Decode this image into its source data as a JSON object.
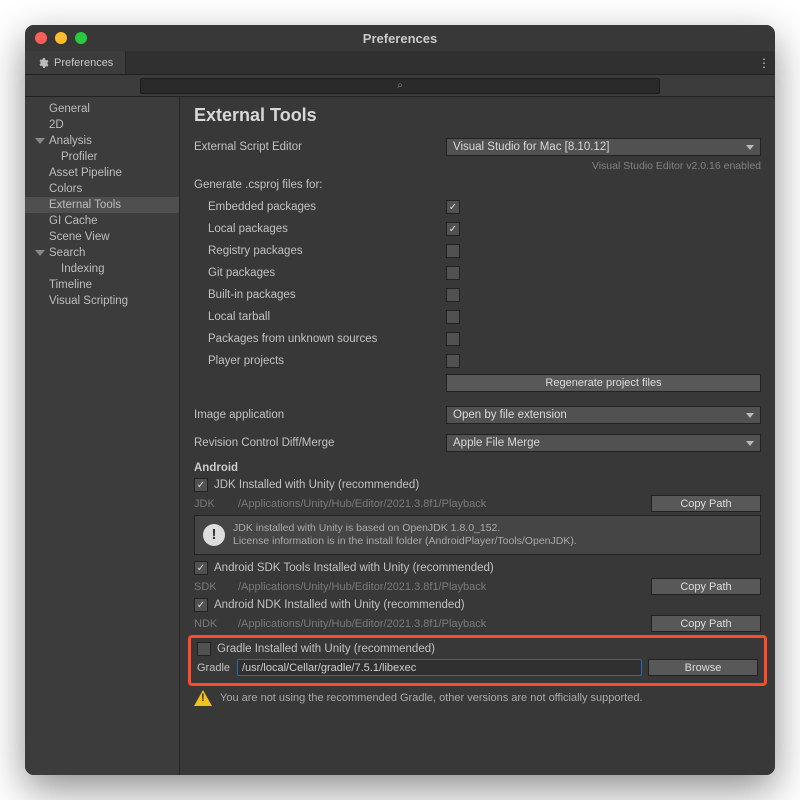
{
  "window": {
    "title": "Preferences"
  },
  "tab": {
    "label": "Preferences"
  },
  "search": {
    "placeholder": "⌕"
  },
  "kebab": "⋮",
  "sidebar": {
    "items": [
      "General",
      "2D",
      "Analysis",
      "Profiler",
      "Asset Pipeline",
      "Colors",
      "External Tools",
      "GI Cache",
      "Scene View",
      "Search",
      "Indexing",
      "Timeline",
      "Visual Scripting"
    ]
  },
  "page": {
    "heading": "External Tools",
    "editorLabel": "External Script Editor",
    "editorValue": "Visual Studio for Mac [8.10.12]",
    "editorNote": "Visual Studio Editor v2.0.16 enabled",
    "csprojLabel": "Generate .csproj files for:",
    "csproj": [
      {
        "label": "Embedded packages",
        "checked": true
      },
      {
        "label": "Local packages",
        "checked": true
      },
      {
        "label": "Registry packages",
        "checked": false
      },
      {
        "label": "Git packages",
        "checked": false
      },
      {
        "label": "Built-in packages",
        "checked": false
      },
      {
        "label": "Local tarball",
        "checked": false
      },
      {
        "label": "Packages from unknown sources",
        "checked": false
      },
      {
        "label": "Player projects",
        "checked": false
      }
    ],
    "regenBtn": "Regenerate project files",
    "imageAppLabel": "Image application",
    "imageAppValue": "Open by file extension",
    "revLabel": "Revision Control Diff/Merge",
    "revValue": "Apple File Merge",
    "androidHeader": "Android",
    "jdk": {
      "chk": "JDK Installed with Unity (recommended)",
      "label": "JDK",
      "path": "/Applications/Unity/Hub/Editor/2021.3.8f1/Playback",
      "btn": "Copy Path"
    },
    "jdkInfo": "JDK installed with Unity is based on OpenJDK 1.8.0_152.\nLicense information is in the install folder (AndroidPlayer/Tools/OpenJDK).",
    "sdk": {
      "chk": "Android SDK Tools Installed with Unity (recommended)",
      "label": "SDK",
      "path": "/Applications/Unity/Hub/Editor/2021.3.8f1/Playback",
      "btn": "Copy Path"
    },
    "ndk": {
      "chk": "Android NDK Installed with Unity (recommended)",
      "label": "NDK",
      "path": "/Applications/Unity/Hub/Editor/2021.3.8f1/Playback",
      "btn": "Copy Path"
    },
    "gradle": {
      "chk": "Gradle Installed with Unity (recommended)",
      "label": "Gradle",
      "path": "/usr/local/Cellar/gradle/7.5.1/libexec",
      "btn": "Browse"
    },
    "warn": "You are not using the recommended Gradle, other versions are not officially supported."
  }
}
